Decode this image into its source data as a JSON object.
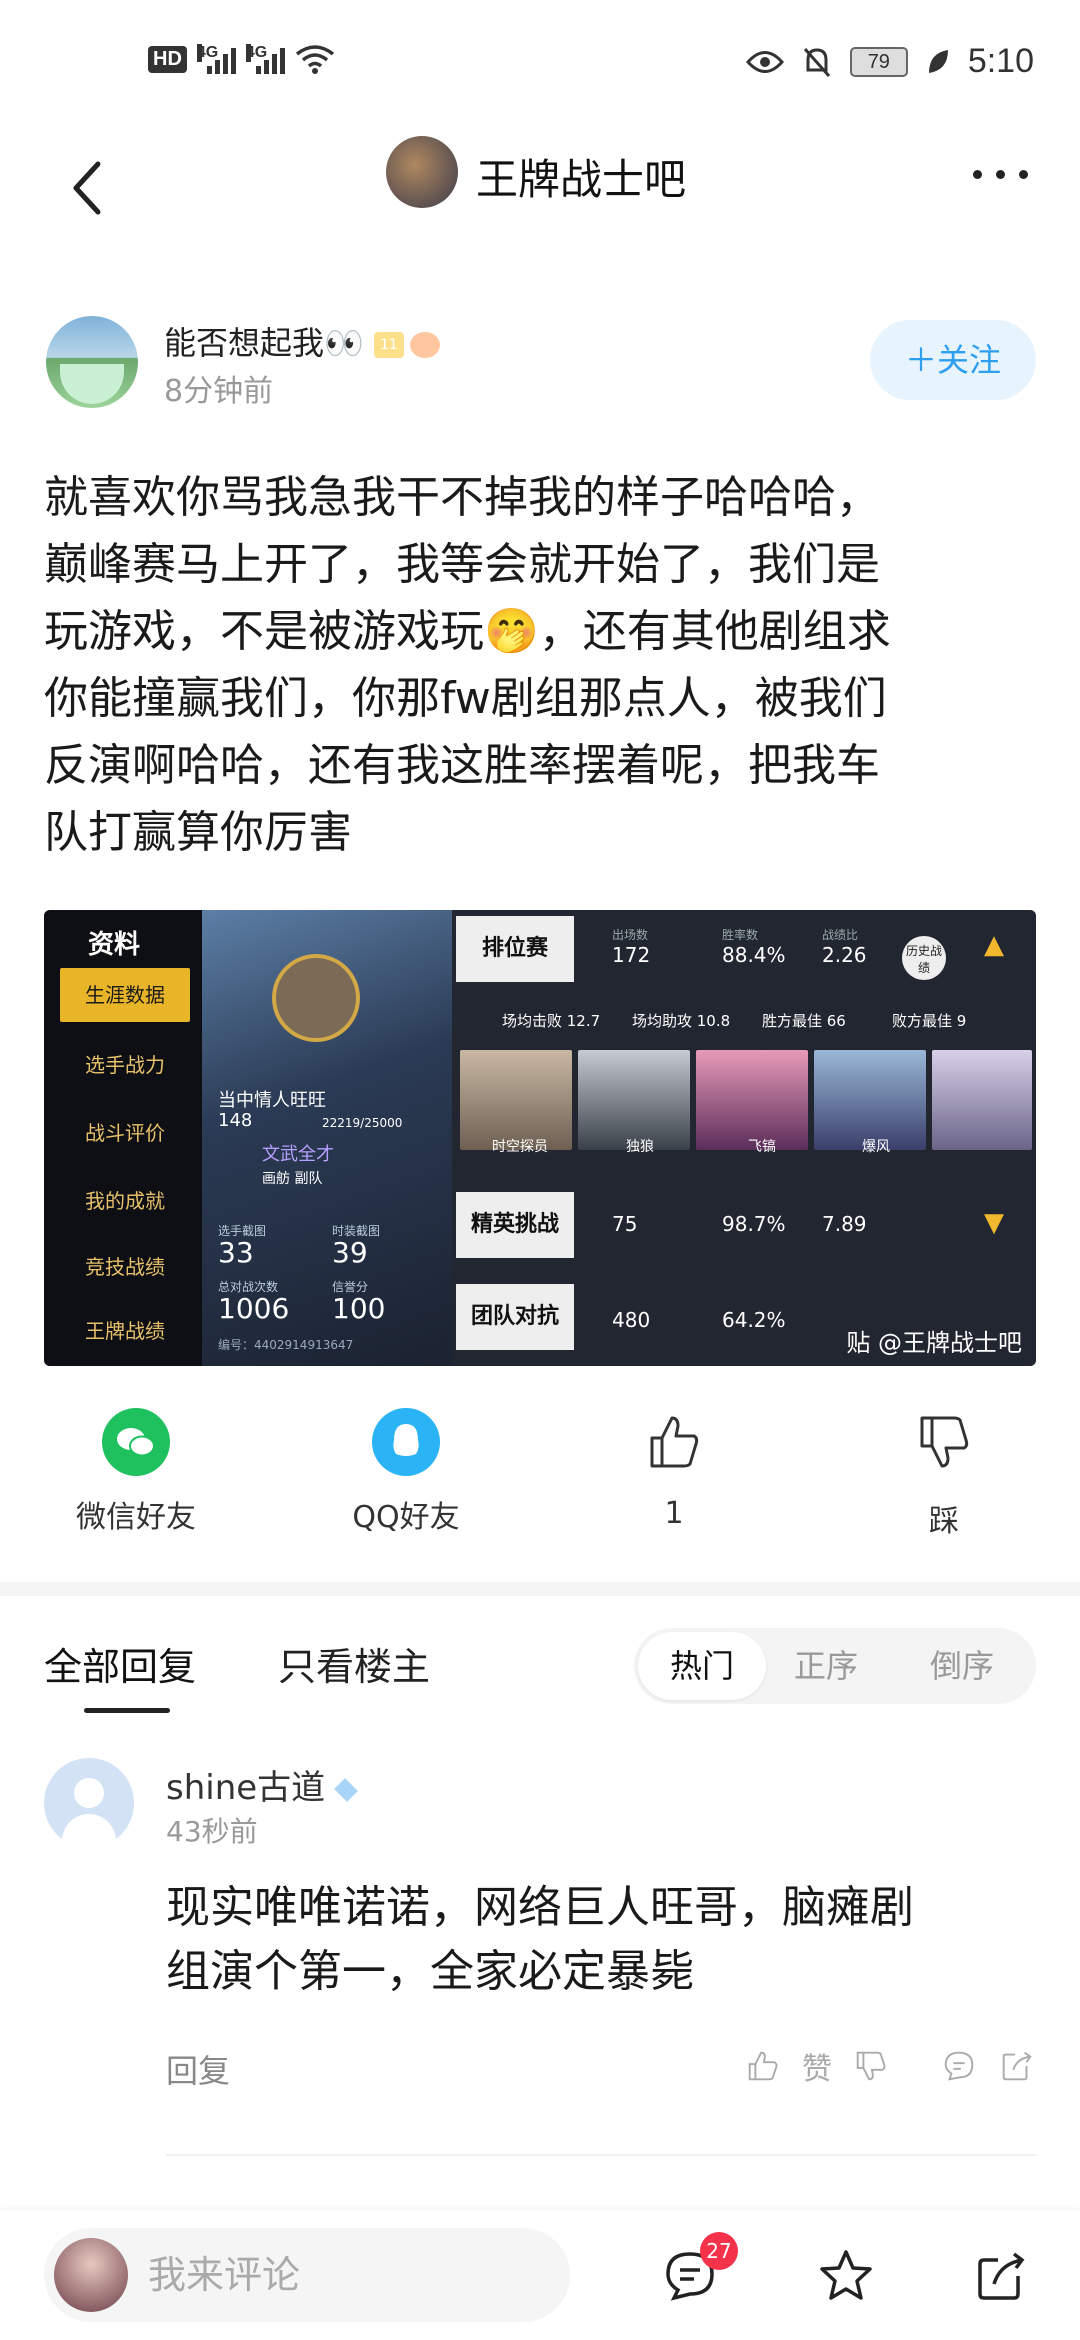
{
  "status_bar": {
    "network_hd": "HD",
    "sim1": "4G",
    "sim2": "4G",
    "battery": "79",
    "time": "5:10"
  },
  "nav": {
    "forum_title": "王牌战士吧"
  },
  "post": {
    "author_name": "能否想起我👀",
    "author_level": "11",
    "time": "8分钟前",
    "follow_label": "＋关注",
    "lines": [
      "就喜欢你骂我急我干不掉我的样子哈哈哈，",
      "巅峰赛马上开了，我等会就开始了，我们是",
      "玩游戏，不是被游戏玩🤭，还有其他剧组求",
      "你能撞赢我们，你那fw剧组那点人，被我们",
      "反演啊哈哈，还有我这胜率摆着呢，把我车",
      "队打赢算你厉害"
    ]
  },
  "image": {
    "logo": "资料",
    "menu": [
      "生涯数据",
      "选手战力",
      "战斗评价",
      "我的成就",
      "竞技战绩",
      "王牌战绩"
    ],
    "player": {
      "name": "当中情人旺旺",
      "level": "148",
      "exp": "22219/25000",
      "title": "文武全才",
      "team": "画舫 副队",
      "stats": [
        {
          "label": "选手截图",
          "value": "33"
        },
        {
          "label": "时装截图",
          "value": "39"
        },
        {
          "label": "总对战次数",
          "value": "1006"
        },
        {
          "label": "信誉分",
          "value": "100"
        }
      ],
      "id": "编号：4402914913647"
    },
    "ranked": {
      "label": "排位赛",
      "matches_label": "出场数",
      "matches": "172",
      "winrate_label": "胜率数",
      "winrate": "88.4%",
      "kd_label": "战绩比",
      "kd": "2.26",
      "history": "历史战绩",
      "avg_kills": "场均击败 12.7",
      "avg_assists": "场均助攻 10.8",
      "win_streak": "胜方最佳 66",
      "lose_best": "败方最佳 9",
      "characters": [
        "时空探员",
        "独狼",
        "飞镐",
        "爆风"
      ]
    },
    "elite": {
      "label": "精英挑战",
      "matches": "75",
      "winrate": "98.7%",
      "kd": "7.89"
    },
    "team_battle": {
      "label": "团队对抗",
      "matches": "480",
      "winrate": "64.2%"
    },
    "watermark": "贴 @王牌战士吧"
  },
  "share": {
    "wechat": "微信好友",
    "qq": "QQ好友",
    "like_count": "1",
    "dislike": "踩"
  },
  "reply_tabs": {
    "all": "全部回复",
    "op_only": "只看楼主",
    "hot": "热门",
    "asc": "正序",
    "desc": "倒序"
  },
  "comment": {
    "name": "shine古道",
    "time": "43秒前",
    "text_lines": [
      "现实唯唯诺诺，网络巨人旺哥，脑瘫剧",
      "组演个第一，全家必定暴毙"
    ],
    "reply": "回复",
    "like": "赞"
  },
  "bottom": {
    "placeholder": "我来评论",
    "message_count": "27"
  }
}
